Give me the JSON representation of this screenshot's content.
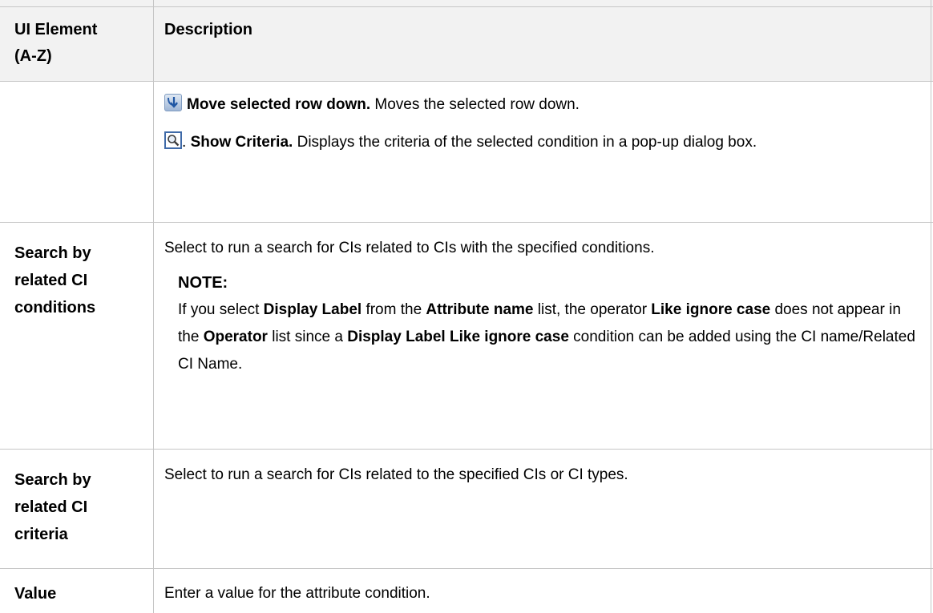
{
  "header": {
    "col1": "UI Element (A-Z)",
    "col1_line1": "UI Element",
    "col1_line2": "(A-Z)",
    "col2": "Description"
  },
  "rows": [
    {
      "term": "",
      "items": [
        {
          "icon": "move-down-icon",
          "label": "Move selected row down.",
          "text": " Moves the selected row down."
        },
        {
          "icon": "magnifier-icon",
          "label": "Show Criteria.",
          "text": " Displays the criteria of the selected condition in a pop-up dialog box."
        }
      ]
    },
    {
      "term_lines": [
        "Search by",
        "related CI",
        "conditions"
      ],
      "description": "Select to run a search for CIs related to CIs with the specified conditions.",
      "note": {
        "title": "NOTE:",
        "s1": "If you select ",
        "b1": "Display Label",
        "s2": " from the ",
        "b2": "Attribute name",
        "s3": " list, the operator ",
        "b3": "Like ignore case",
        "s4": " does not appear in the ",
        "b4": "Operator",
        "s5": " list since a ",
        "b5": "Display Label Like ignore case",
        "s6": " condition can be added using the CI name/Related CI Name."
      }
    },
    {
      "term_lines": [
        "Search by",
        "related CI",
        "criteria"
      ],
      "description": "Select to run a search for CIs related to the specified CIs or CI types."
    },
    {
      "term": "Value",
      "description": "Enter a value for the attribute condition."
    }
  ]
}
